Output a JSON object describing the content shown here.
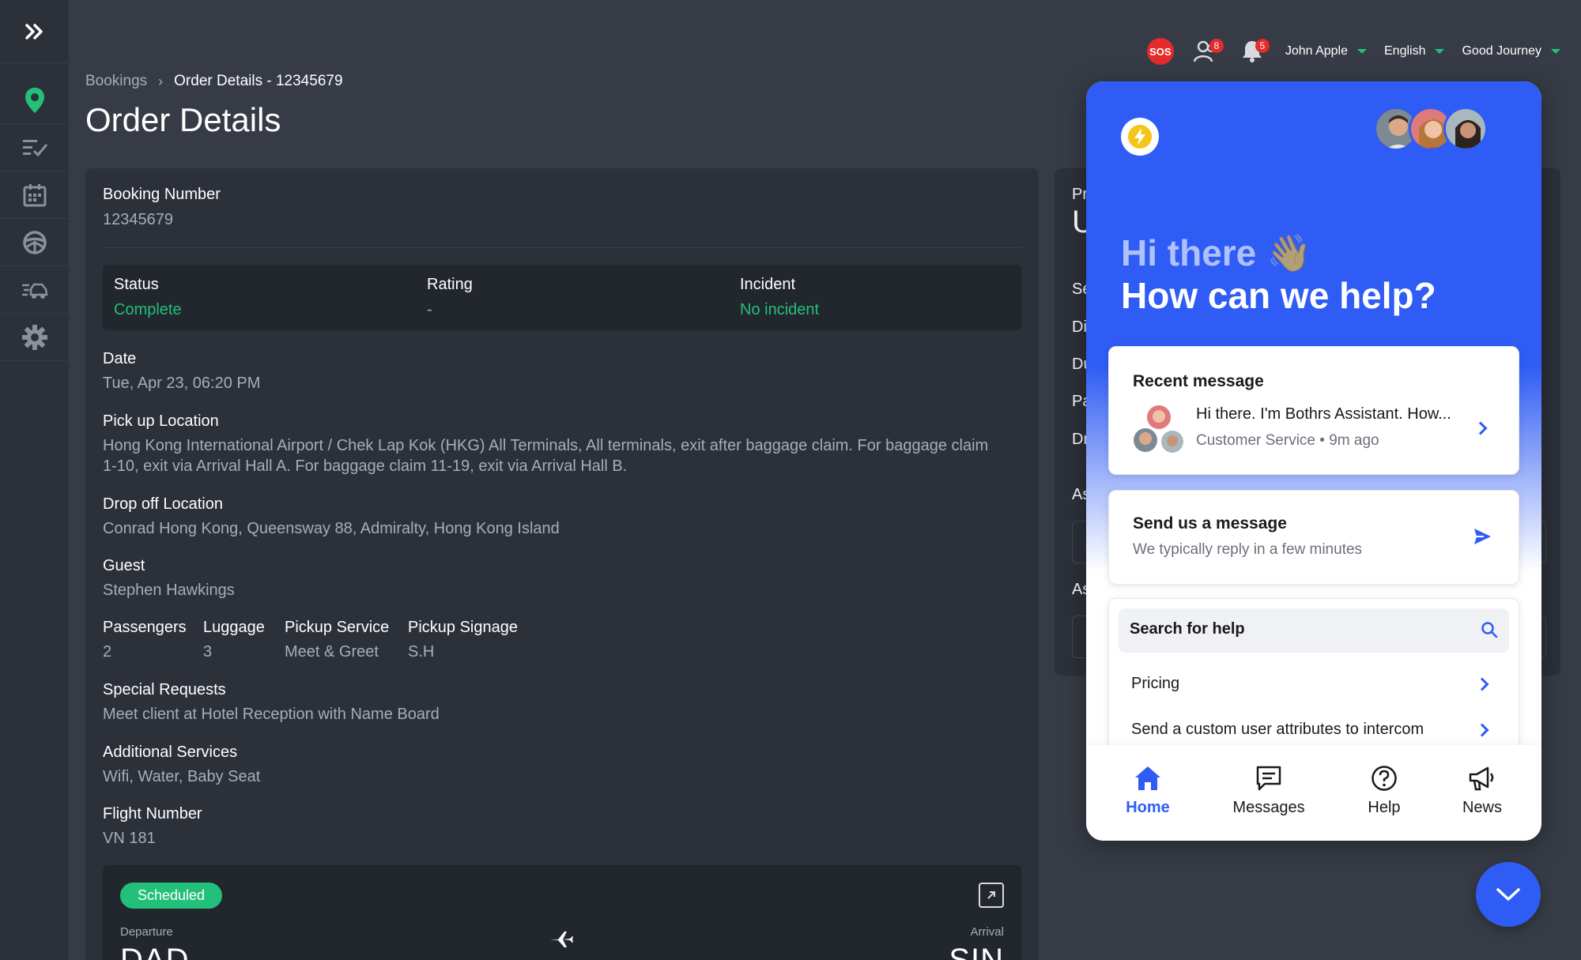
{
  "sidebar": {
    "items": [
      {
        "icon": "location-pin-icon",
        "active": true
      },
      {
        "icon": "tasks-icon"
      },
      {
        "icon": "calendar-icon"
      },
      {
        "icon": "steering-wheel-icon"
      },
      {
        "icon": "fast-car-icon"
      },
      {
        "icon": "gear-icon"
      }
    ]
  },
  "topbar": {
    "sos_label": "SOS",
    "users_count": "8",
    "notifications_count": "5",
    "user_name": "John Apple",
    "language": "English",
    "company": "Good Journey"
  },
  "breadcrumb": {
    "parent": "Bookings",
    "current": "Order Details - 12345679"
  },
  "page": {
    "title": "Order Details"
  },
  "booking": {
    "booking_number_label": "Booking Number",
    "booking_number": "12345679",
    "status_label": "Status",
    "status": "Complete",
    "rating_label": "Rating",
    "rating": "-",
    "incident_label": "Incident",
    "incident": "No incident",
    "date_label": "Date",
    "date": "Tue, Apr 23, 06:20 PM",
    "pickup_label": "Pick up Location",
    "pickup_line1": "Hong Kong International Airport / Chek Lap Kok (HKG) All Terminals, All terminals, exit after baggage claim. For baggage claim",
    "pickup_line2": "1-10, exit via Arrival Hall A. For baggage claim 11-19, exit via Arrival Hall B.",
    "dropoff_label": "Drop off Location",
    "dropoff": "Conrad Hong Kong, Queensway 88, Admiralty, Hong Kong Island",
    "guest_label": "Guest",
    "guest": "Stephen Hawkings",
    "passengers_label": "Passengers",
    "passengers": "2",
    "luggage_label": "Luggage",
    "luggage": "3",
    "pickup_service_label": "Pickup Service",
    "pickup_service": "Meet & Greet",
    "pickup_signage_label": "Pickup Signage",
    "pickup_signage": "S.H",
    "special_label": "Special Requests",
    "special": "Meet client at Hotel Reception with Name Board",
    "additional_label": "Additional Services",
    "additional": "Wifi, Water, Baby Seat",
    "flight_label": "Flight Number",
    "flight": "VN 181"
  },
  "flight_card": {
    "status": "Scheduled",
    "departure_label": "Departure",
    "departure_code": "DAD",
    "arrival_label": "Arrival",
    "arrival_code": "SIN"
  },
  "right_card": {
    "title_fragment": "Pr",
    "big_fragment": "U",
    "rows": [
      "Se",
      "Di",
      "Du",
      "Pa",
      "Dr"
    ],
    "section1": "As",
    "section2": "As"
  },
  "intercom": {
    "greeting": "Hi there 👋",
    "headline": "How can we help?",
    "recent_title": "Recent message",
    "recent_text": "Hi there. I'm Bothrs Assistant. How...",
    "recent_meta": "Customer Service • 9m ago",
    "send_title": "Send us a message",
    "send_sub": "We typically reply in a few minutes",
    "search_placeholder": "Search for help",
    "help_items": [
      "Pricing",
      "Send a custom user attributes to intercom"
    ],
    "tabs": [
      {
        "label": "Home",
        "icon": "home-icon",
        "active": true
      },
      {
        "label": "Messages",
        "icon": "messages-icon"
      },
      {
        "label": "Help",
        "icon": "help-icon"
      },
      {
        "label": "News",
        "icon": "megaphone-icon"
      }
    ],
    "accent": "#2f5cf4"
  },
  "colors": {
    "background": "#363b45",
    "card": "#2c3039",
    "success": "#22c07a",
    "badge": "#e32b2b"
  }
}
